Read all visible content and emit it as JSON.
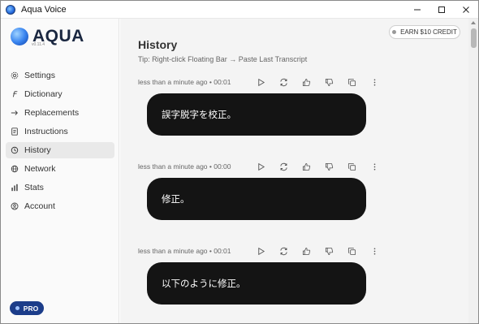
{
  "window": {
    "title": "Aqua Voice"
  },
  "sidebar": {
    "logo": {
      "text": "AQUA",
      "version": "v0.11.4"
    },
    "items": [
      {
        "label": "Settings",
        "icon": "gear-icon",
        "active": false
      },
      {
        "label": "Dictionary",
        "icon": "dictionary-icon",
        "active": false
      },
      {
        "label": "Replacements",
        "icon": "arrow-right-icon",
        "active": false
      },
      {
        "label": "Instructions",
        "icon": "document-icon",
        "active": false
      },
      {
        "label": "History",
        "icon": "history-icon",
        "active": true
      },
      {
        "label": "Network",
        "icon": "globe-icon",
        "active": false
      },
      {
        "label": "Stats",
        "icon": "bar-chart-icon",
        "active": false
      },
      {
        "label": "Account",
        "icon": "account-icon",
        "active": false
      }
    ],
    "pro_label": "PRO"
  },
  "header": {
    "earn_label": "EARN $10 CREDIT",
    "title": "History",
    "tip": "Tip: Right-click Floating Bar → Paste Last Transcript"
  },
  "history": [
    {
      "meta": "less than a minute ago • 00:01",
      "text": "誤字脱字を校正。"
    },
    {
      "meta": "less than a minute ago • 00:00",
      "text": "修正。"
    },
    {
      "meta": "less than a minute ago • 00:01",
      "text": "以下のように修正。"
    }
  ],
  "colors": {
    "accent": "#1c3d8a",
    "bubble": "#141414"
  }
}
